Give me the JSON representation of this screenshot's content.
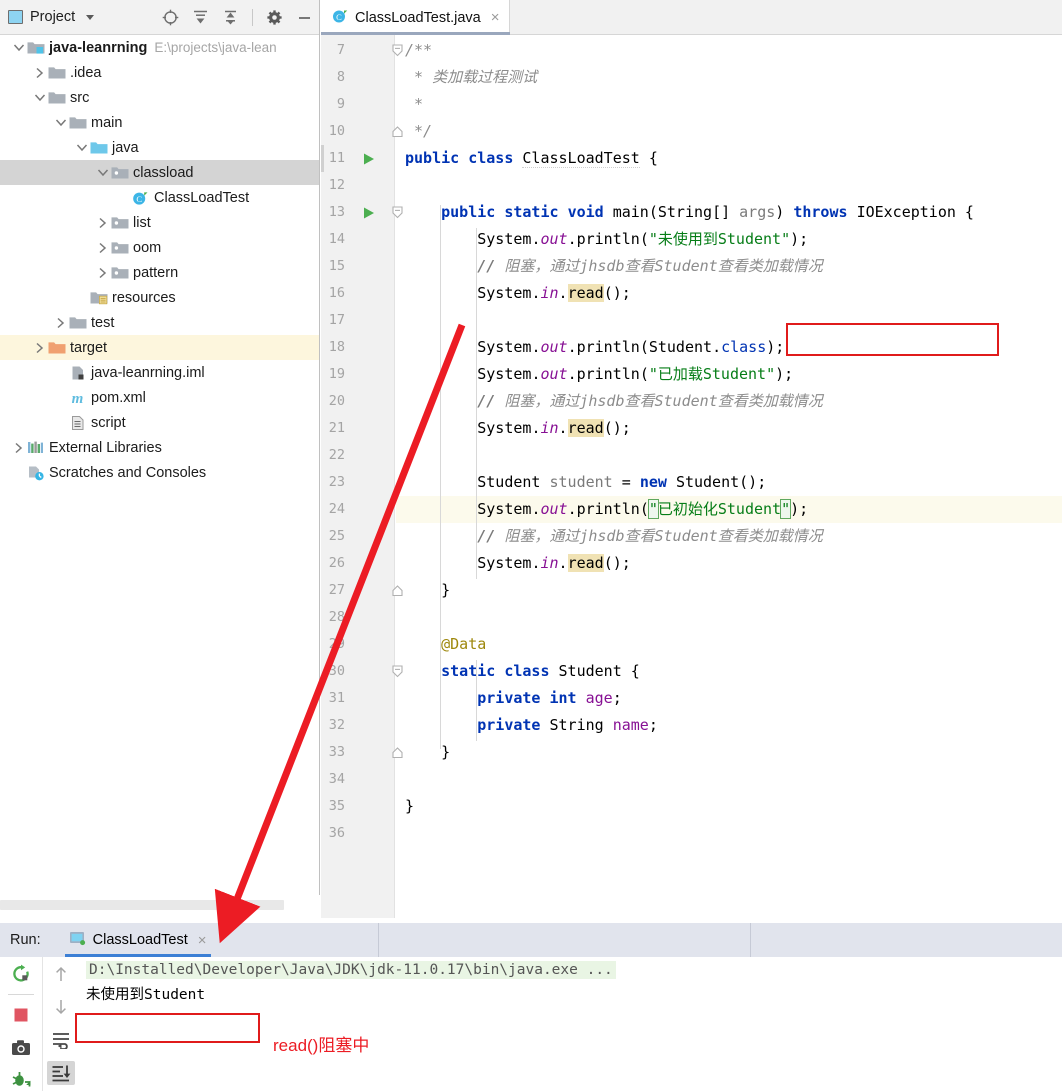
{
  "project_panel": {
    "title": "Project",
    "icons": [
      "project-select-icon",
      "expand-all-icon",
      "collapse-all-icon",
      "gear-icon",
      "minimize-icon"
    ],
    "tree": [
      {
        "label": "java-leanrning",
        "path": "E:\\projects\\java-lean",
        "depth": 0,
        "arrow": "down",
        "icon": "module-folder-icon",
        "bold": true,
        "state": "normal"
      },
      {
        "label": ".idea",
        "path": "",
        "depth": 1,
        "arrow": "right",
        "icon": "folder-icon",
        "bold": false,
        "state": "normal"
      },
      {
        "label": "src",
        "path": "",
        "depth": 1,
        "arrow": "down",
        "icon": "folder-icon",
        "bold": false,
        "state": "normal"
      },
      {
        "label": "main",
        "path": "",
        "depth": 2,
        "arrow": "down",
        "icon": "folder-icon",
        "bold": false,
        "state": "normal"
      },
      {
        "label": "java",
        "path": "",
        "depth": 3,
        "arrow": "down",
        "icon": "source-folder-icon",
        "bold": false,
        "state": "normal"
      },
      {
        "label": "classload",
        "path": "",
        "depth": 4,
        "arrow": "down",
        "icon": "package-icon",
        "bold": false,
        "state": "selected"
      },
      {
        "label": "ClassLoadTest",
        "path": "",
        "depth": 5,
        "arrow": "none",
        "icon": "java-class-icon",
        "bold": false,
        "state": "normal"
      },
      {
        "label": "list",
        "path": "",
        "depth": 4,
        "arrow": "right",
        "icon": "package-icon",
        "bold": false,
        "state": "normal"
      },
      {
        "label": "oom",
        "path": "",
        "depth": 4,
        "arrow": "right",
        "icon": "package-icon",
        "bold": false,
        "state": "normal"
      },
      {
        "label": "pattern",
        "path": "",
        "depth": 4,
        "arrow": "right",
        "icon": "package-icon",
        "bold": false,
        "state": "normal"
      },
      {
        "label": "resources",
        "path": "",
        "depth": 3,
        "arrow": "none",
        "icon": "resources-folder-icon",
        "bold": false,
        "state": "normal"
      },
      {
        "label": "test",
        "path": "",
        "depth": 2,
        "arrow": "right",
        "icon": "folder-icon",
        "bold": false,
        "state": "normal"
      },
      {
        "label": "target",
        "path": "",
        "depth": 1,
        "arrow": "right",
        "icon": "excluded-folder-icon",
        "bold": false,
        "state": "highlighted"
      },
      {
        "label": "java-leanrning.iml",
        "path": "",
        "depth": 2,
        "arrow": "none",
        "icon": "iml-file-icon",
        "bold": false,
        "state": "normal"
      },
      {
        "label": "pom.xml",
        "path": "",
        "depth": 2,
        "arrow": "none",
        "icon": "maven-icon",
        "bold": false,
        "state": "normal"
      },
      {
        "label": "script",
        "path": "",
        "depth": 2,
        "arrow": "none",
        "icon": "file-icon",
        "bold": false,
        "state": "normal"
      },
      {
        "label": "External Libraries",
        "path": "",
        "depth": 0,
        "arrow": "right",
        "icon": "libraries-icon",
        "bold": false,
        "state": "normal"
      },
      {
        "label": "Scratches and Consoles",
        "path": "",
        "depth": 0,
        "arrow": "none",
        "icon": "scratches-icon",
        "bold": false,
        "state": "normal"
      }
    ]
  },
  "editor": {
    "tab": {
      "label": "ClassLoadTest.java",
      "icon": "java-class-icon",
      "close": "×"
    },
    "first_line": 7,
    "current_line": 24,
    "lines": [
      {
        "n": 7,
        "run": false,
        "fold": "start-open"
      },
      {
        "n": 8,
        "run": false,
        "fold": ""
      },
      {
        "n": 9,
        "run": false,
        "fold": ""
      },
      {
        "n": 10,
        "run": false,
        "fold": "end"
      },
      {
        "n": 11,
        "run": true,
        "fold": ""
      },
      {
        "n": 12,
        "run": false,
        "fold": ""
      },
      {
        "n": 13,
        "run": true,
        "fold": "start-open"
      },
      {
        "n": 14,
        "run": false,
        "fold": ""
      },
      {
        "n": 15,
        "run": false,
        "fold": ""
      },
      {
        "n": 16,
        "run": false,
        "fold": ""
      },
      {
        "n": 17,
        "run": false,
        "fold": ""
      },
      {
        "n": 18,
        "run": false,
        "fold": ""
      },
      {
        "n": 19,
        "run": false,
        "fold": ""
      },
      {
        "n": 20,
        "run": false,
        "fold": ""
      },
      {
        "n": 21,
        "run": false,
        "fold": ""
      },
      {
        "n": 22,
        "run": false,
        "fold": ""
      },
      {
        "n": 23,
        "run": false,
        "fold": ""
      },
      {
        "n": 24,
        "run": false,
        "fold": ""
      },
      {
        "n": 25,
        "run": false,
        "fold": ""
      },
      {
        "n": 26,
        "run": false,
        "fold": ""
      },
      {
        "n": 27,
        "run": false,
        "fold": "end"
      },
      {
        "n": 28,
        "run": false,
        "fold": ""
      },
      {
        "n": 29,
        "run": false,
        "fold": ""
      },
      {
        "n": 30,
        "run": false,
        "fold": "start-open"
      },
      {
        "n": 31,
        "run": false,
        "fold": ""
      },
      {
        "n": 32,
        "run": false,
        "fold": ""
      },
      {
        "n": 33,
        "run": false,
        "fold": "end"
      },
      {
        "n": 34,
        "run": false,
        "fold": ""
      },
      {
        "n": 35,
        "run": false,
        "fold": ""
      },
      {
        "n": 36,
        "run": false,
        "fold": ""
      }
    ],
    "code_text": [
      "/**",
      " * 类加载过程测试",
      " *",
      " */",
      "public class ClassLoadTest {",
      "",
      "    public static void main(String[] args) throws IOException {",
      "        System.out.println(\"未使用到Student\");",
      "        // 阻塞，通过jhsdb查看Student查看类加载情况",
      "        System.in.read();",
      "",
      "        System.out.println(Student.class);",
      "        System.out.println(\"已加载Student\");",
      "        // 阻塞，通过jhsdb查看Student查看类加载情况",
      "        System.in.read();",
      "",
      "        Student student = new Student();",
      "        System.out.println(\"已初始化Student\");",
      "        // 阻塞，通过jhsdb查看Student查看类加载情况",
      "        System.in.read();",
      "    }",
      "",
      "    @Data",
      "    static class Student {",
      "        private int age;",
      "        private String name;",
      "    }",
      "",
      "}",
      ""
    ],
    "tokens": {
      "comment_block_open": "/**",
      "comment_title": " * 类加载过程测试",
      "comment_star": " *",
      "comment_close": " */",
      "kw_public": "public",
      "kw_class": "class",
      "kw_static": "static",
      "kw_void": "void",
      "kw_new": "new",
      "kw_private": "private",
      "kw_int": "int",
      "kw_throws": "throws",
      "type_ClassLoadTest": "ClassLoadTest",
      "type_String": "String",
      "type_IOException": "IOException",
      "type_Student": "Student",
      "sym_System": "System",
      "fld_out": "out",
      "fld_in": "in",
      "m_println": "println",
      "m_read": "read",
      "m_main": "main",
      "args": "args",
      "var_student": "student",
      "str1": "\"未使用到Student\"",
      "str2": "\"已加载Student\"",
      "str3": "已初始化Student",
      "comment_line": "// 阻塞，通过jhsdb查看Student查看类加载情况",
      "anno_data": "@Data",
      "kw_classprop": "class"
    }
  },
  "run_panel": {
    "label": "Run:",
    "tab_label": "ClassLoadTest",
    "tab_close": "×",
    "left_tools": [
      "rerun-icon",
      "stop-icon",
      "camera-icon",
      "debug-icon"
    ],
    "nav_tools": [
      "up-arrow-icon",
      "down-arrow-icon",
      "soft-wrap-icon",
      "scroll-to-end-icon"
    ],
    "console": {
      "command": "D:\\Installed\\Developer\\Java\\JDK\\jdk-11.0.17\\bin\\java.exe ...",
      "output_line": "未使用到Student"
    }
  },
  "annotations": {
    "note_text": "read()阻塞中",
    "accent_red": "#e01b1b",
    "note_color": "#ec1c24",
    "arrow_color": "#ec1c24"
  }
}
